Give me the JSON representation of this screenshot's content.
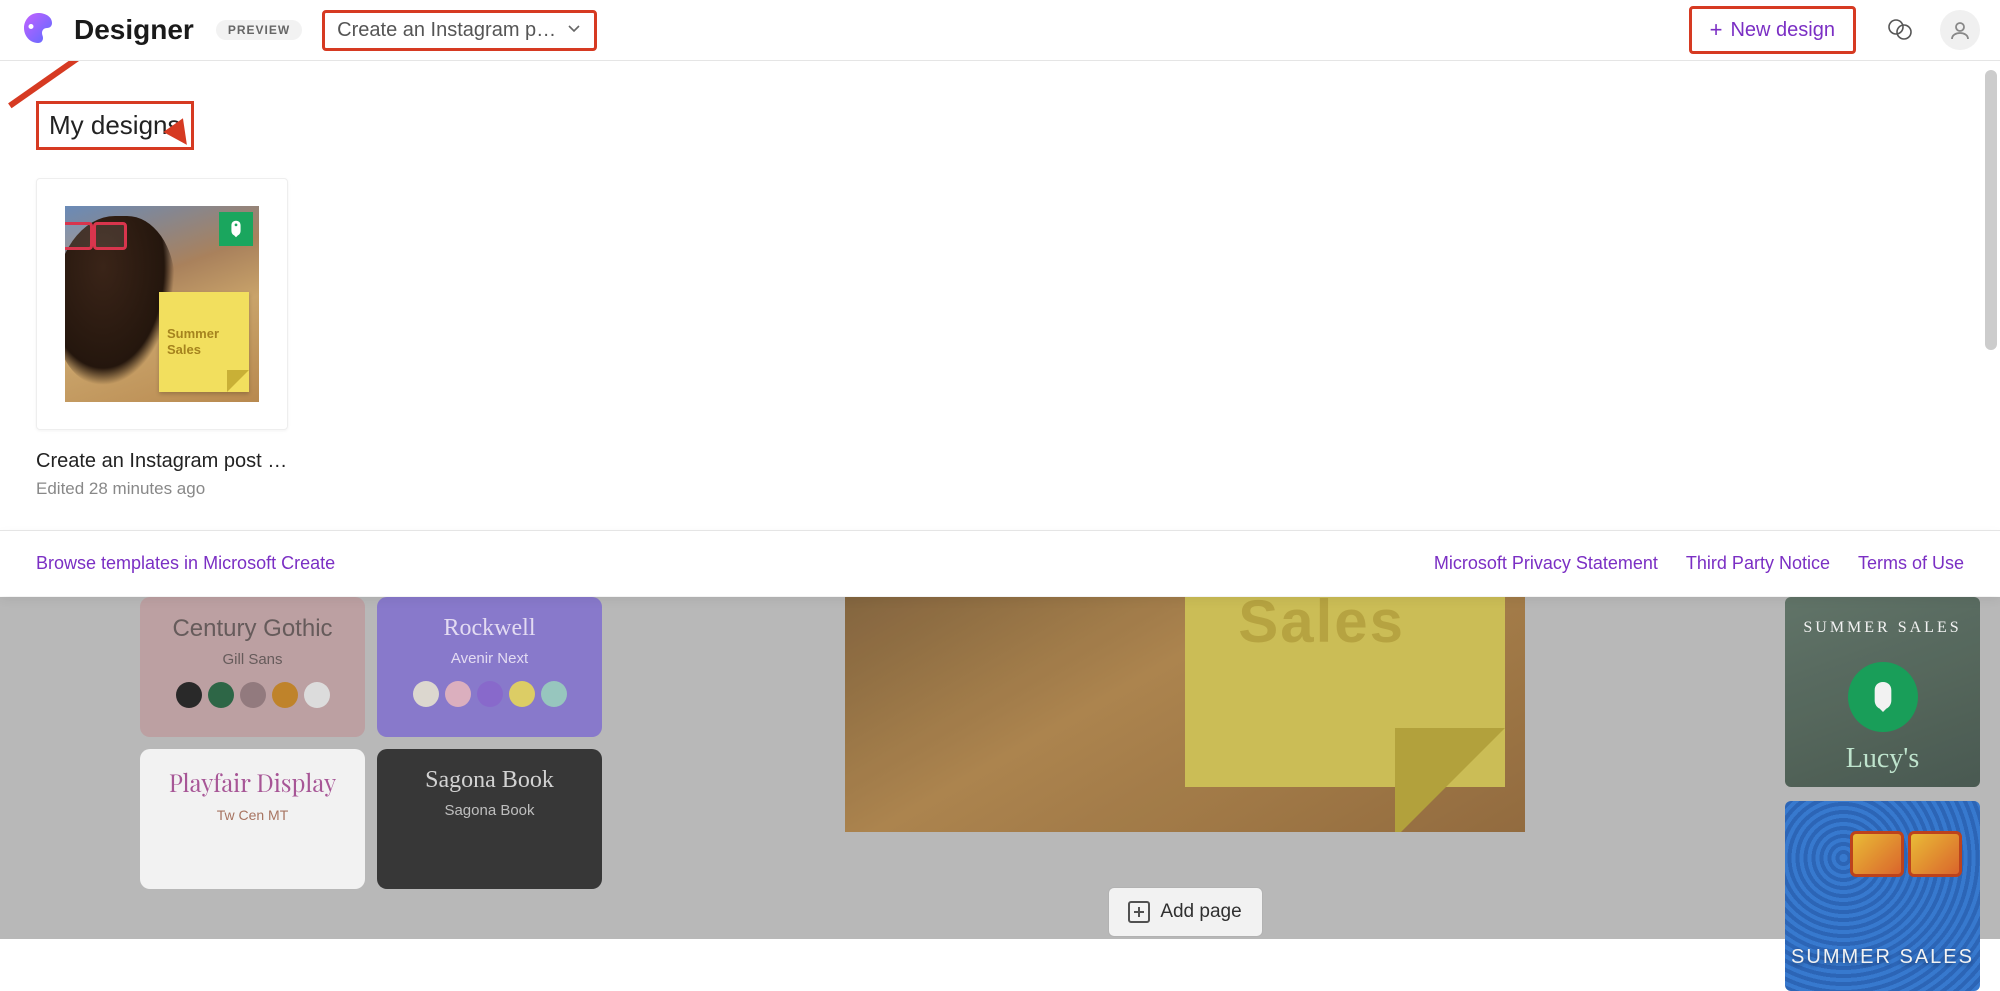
{
  "header": {
    "app_name": "Designer",
    "badge": "PREVIEW",
    "doc_title": "Create an Instagram p…",
    "new_design_label": "New design"
  },
  "section": {
    "title": "My designs"
  },
  "designs": [
    {
      "title": "Create an Instagram post …",
      "meta": "Edited 28 minutes ago",
      "sticky_text": "Summer Sales"
    }
  ],
  "footer": {
    "browse": "Browse templates in Microsoft Create",
    "privacy": "Microsoft Privacy Statement",
    "third_party": "Third Party Notice",
    "terms": "Terms of Use"
  },
  "bg": {
    "font_cards": [
      {
        "main": "Century Gothic",
        "sub": "Gill Sans",
        "dots": [
          "#2b2b2b",
          "#2f6b4a",
          "#9a8085",
          "#c98a2c",
          "#e8e8e8"
        ]
      },
      {
        "main": "Rockwell",
        "sub": "Avenir Next",
        "dots": [
          "#e8e2da",
          "#e6b8c8",
          "#8f6fd6",
          "#e8d86a",
          "#9fd0c8"
        ]
      },
      {
        "main": "Playfair Display",
        "sub": "Tw Cen MT",
        "dots": []
      },
      {
        "main": "Sagona Book",
        "sub": "Sagona Book",
        "dots": []
      }
    ],
    "canvas_text": "Sales",
    "add_page": "Add page",
    "side1_label": "SUMMER  SALES",
    "side1_script": "Lucy's",
    "side2_label": "SUMMER SALES"
  },
  "annotations": {
    "boxes": [
      "doc-title-dropdown",
      "new-design-button",
      "section-title"
    ],
    "arrows": 2,
    "color": "#d63a22"
  }
}
